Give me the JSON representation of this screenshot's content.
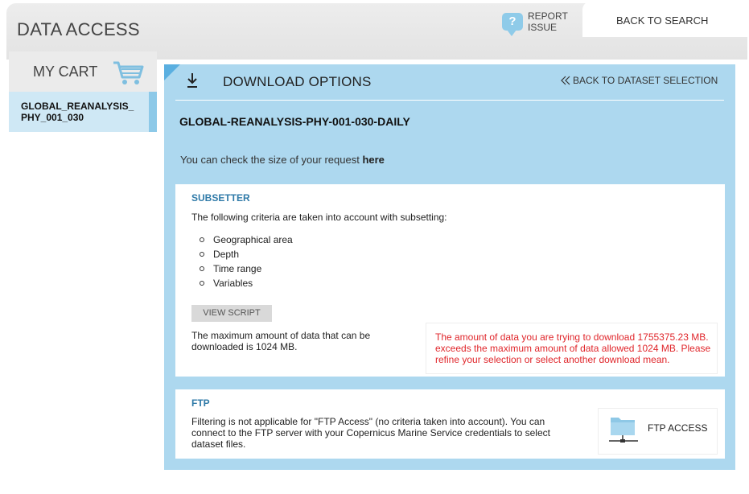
{
  "header": {
    "title": "DATA ACCESS",
    "report_issue": "REPORT ISSUE",
    "back_to_search": "BACK TO SEARCH"
  },
  "cart": {
    "title": "MY CART",
    "items": [
      {
        "label": "GLOBAL_REANALYSIS_\nPHY_001_030"
      }
    ]
  },
  "main": {
    "title": "DOWNLOAD OPTIONS",
    "back_link": "BACK TO DATASET SELECTION",
    "dataset": "GLOBAL-REANALYSIS-PHY-001-030-DAILY",
    "size_check_prefix": "You can check the size of your request",
    "size_check_link": "here"
  },
  "subsetter": {
    "title": "SUBSETTER",
    "intro": "The following criteria are taken into account with subsetting:",
    "criteria": [
      "Geographical area",
      "Depth",
      "Time range",
      "Variables"
    ],
    "view_script": "VIEW SCRIPT",
    "max_info": "The maximum amount of data that can be downloaded is 1024 MB.",
    "error": "The amount of data you are trying to download 1755375.23 MB. exceeds the maximum amount of data allowed 1024 MB. Please refine your selection or select another download mean."
  },
  "ftp": {
    "title": "FTP",
    "text": "Filtering is not applicable for \"FTP Access\" (no criteria taken into account). You can connect to the FTP server with your Copernicus Marine Service credentials to select dataset files.",
    "button": "FTP ACCESS"
  },
  "colors": {
    "panel": "#add8ef",
    "accent": "#2f7aa8",
    "error": "#e0262b",
    "cart_item": "#cfe8f5"
  }
}
